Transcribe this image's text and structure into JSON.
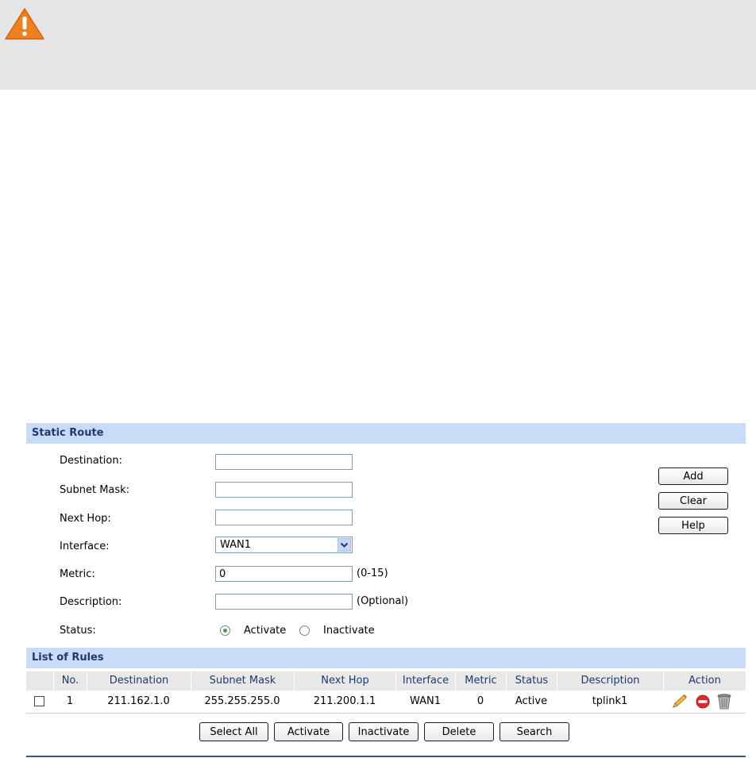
{
  "static_route": {
    "title": "Static Route",
    "labels": {
      "destination": "Destination:",
      "subnet_mask": "Subnet Mask:",
      "next_hop": "Next Hop:",
      "interface": "Interface:",
      "metric": "Metric:",
      "description": "Description:",
      "status": "Status:"
    },
    "values": {
      "destination": "",
      "subnet_mask": "",
      "next_hop": "",
      "interface": "WAN1",
      "metric": "0",
      "description": ""
    },
    "hints": {
      "metric": "(0-15)",
      "description": "(Optional)"
    },
    "status_options": [
      "Activate",
      "Inactivate"
    ],
    "status_selected": "Activate",
    "buttons": {
      "add": "Add",
      "clear": "Clear",
      "help": "Help"
    }
  },
  "list_of_rules": {
    "title": "List of Rules",
    "columns": [
      "No.",
      "Destination",
      "Subnet Mask",
      "Next Hop",
      "Interface",
      "Metric",
      "Status",
      "Description",
      "Action"
    ],
    "rows": [
      {
        "no": "1",
        "destination": "211.162.1.0",
        "subnet_mask": "255.255.255.0",
        "next_hop": "211.200.1.1",
        "interface": "WAN1",
        "metric": "0",
        "status": "Active",
        "description": "tplink1",
        "actions": [
          "edit-icon",
          "disable-icon",
          "delete-icon"
        ]
      }
    ],
    "buttons": {
      "select_all": "Select All",
      "activate": "Activate",
      "inactivate": "Inactivate",
      "delete": "Delete",
      "search": "Search"
    }
  },
  "colors": {
    "header_bg": "#c9dcf7",
    "header_text": "#1f3a6e",
    "warning": "#f07f1e"
  }
}
